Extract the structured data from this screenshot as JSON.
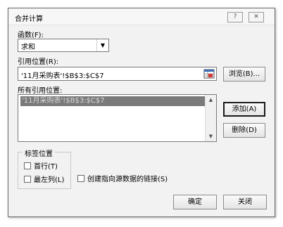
{
  "window": {
    "title": "合并计算",
    "help_label": "?",
    "close_label": "✕"
  },
  "function": {
    "label": "函数(F):",
    "value": "求和"
  },
  "reference": {
    "label": "引用位置(R):",
    "value": "'11月采购表'!$B$3:$C$7",
    "collapse_icon": "range-select-icon"
  },
  "buttons": {
    "browse": "浏览(B)...",
    "add": "添加(A)",
    "delete": "删除(D)",
    "ok": "确定",
    "close": "关闭"
  },
  "all_references": {
    "label": "所有引用位置:",
    "items": [
      "'11月采购表'!$B$3:$C$7"
    ]
  },
  "label_position": {
    "title": "标签位置",
    "first_row": "首行(T)",
    "left_column": "最左列(L)"
  },
  "create_links": "创建指向源数据的链接(S)",
  "checkboxes": {
    "first_row_checked": false,
    "left_column_checked": false,
    "create_links_checked": false
  }
}
